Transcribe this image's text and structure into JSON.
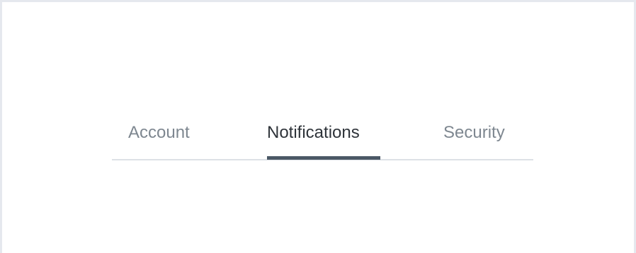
{
  "tabs": [
    {
      "label": "Account",
      "active": false
    },
    {
      "label": "Notifications",
      "active": true
    },
    {
      "label": "Security",
      "active": false
    }
  ],
  "colors": {
    "active_text": "#2f343a",
    "inactive_text": "#7e8790",
    "active_indicator": "#4b5866",
    "baseline": "#dde1e6",
    "frame_border": "#e5e8ee"
  }
}
